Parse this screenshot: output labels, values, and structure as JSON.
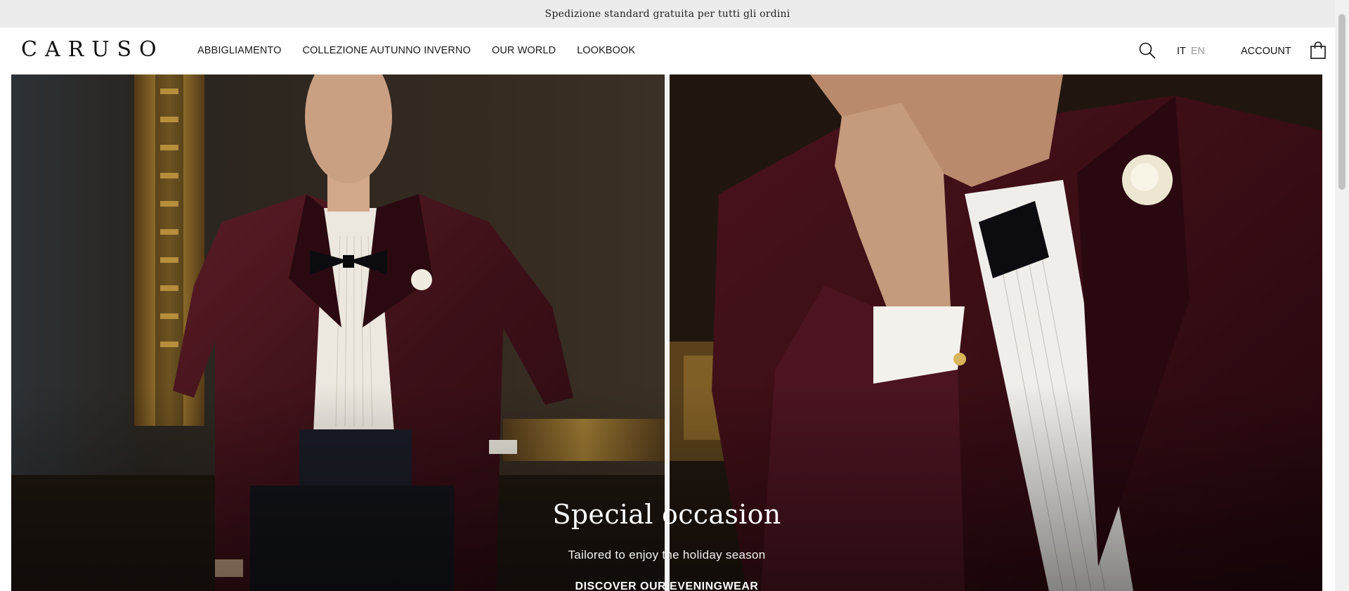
{
  "announcement": {
    "text": "Spedizione standard gratuita per tutti gli ordini"
  },
  "header": {
    "logo": "CARUSO",
    "nav": [
      {
        "label": "ABBIGLIAMENTO"
      },
      {
        "label": "COLLEZIONE AUTUNNO INVERNO"
      },
      {
        "label": "OUR WORLD"
      },
      {
        "label": "LOOKBOOK"
      }
    ],
    "search_icon": "search-icon",
    "language": {
      "active": "IT",
      "inactive": "EN"
    },
    "account_label": "ACCOUNT",
    "bag_icon": "shopping-bag-icon"
  },
  "hero": {
    "title": "Special occasion",
    "subtitle": "Tailored to enjoy the holiday season",
    "cta": "DISCOVER OUR EVENINGWEAR"
  },
  "colors": {
    "announcement_bg": "#ececec",
    "header_bg": "#ffffff",
    "velvet_burgundy": "#4e1820",
    "hero_text": "#ffffff"
  }
}
